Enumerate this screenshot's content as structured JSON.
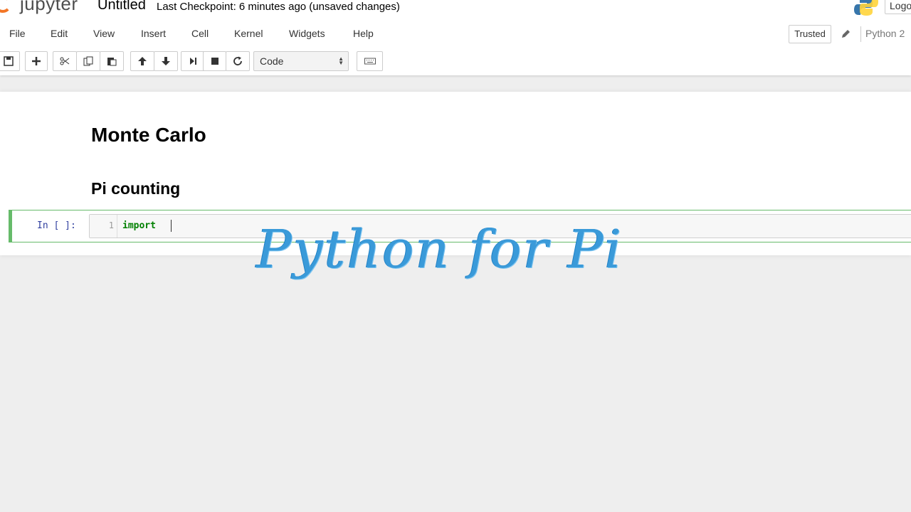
{
  "header": {
    "logo_text": "jupyter",
    "notebook_name": "Untitled",
    "checkpoint": "Last Checkpoint: 6 minutes ago (unsaved changes)",
    "logout_label": "Logo"
  },
  "menubar": {
    "items": [
      "File",
      "Edit",
      "View",
      "Insert",
      "Cell",
      "Kernel",
      "Widgets",
      "Help"
    ],
    "trusted_label": "Trusted",
    "kernel_name": "Python 2"
  },
  "toolbar": {
    "buttons": [
      "save-icon",
      "plus-icon",
      "cut-icon",
      "copy-icon",
      "paste-icon",
      "arrow-up-icon",
      "arrow-down-icon",
      "run-step-icon",
      "stop-icon",
      "restart-icon",
      "keyboard-icon"
    ],
    "cell_type": "Code"
  },
  "notebook": {
    "heading1": "Monte Carlo",
    "heading2": "Pi counting",
    "cell": {
      "prompt": "In [ ]:",
      "line_number": "1",
      "code": "import"
    }
  },
  "overlay": {
    "caption": "Python for Pi",
    "color": "#3a9ad9"
  },
  "colors": {
    "accent": "#f37626",
    "cell_border": "#66bb6a",
    "prompt": "#303f9f",
    "keyword": "#008000"
  }
}
